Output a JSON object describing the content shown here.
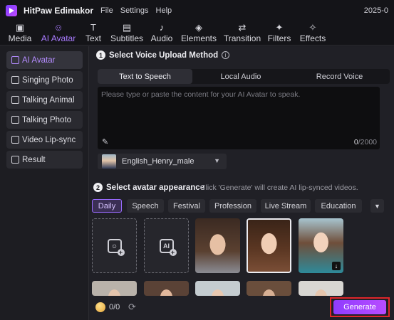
{
  "app": {
    "name": "HitPaw Edimakor",
    "date": "2025-0"
  },
  "menu": [
    "File",
    "Settings",
    "Help"
  ],
  "toolbar": [
    {
      "label": "Media",
      "icon": "media-icon",
      "glyph": "▣"
    },
    {
      "label": "AI Avatar",
      "icon": "ai-avatar-icon",
      "glyph": "☺",
      "active": true
    },
    {
      "label": "Text",
      "icon": "text-icon",
      "glyph": "T"
    },
    {
      "label": "Subtitles",
      "icon": "subtitles-icon",
      "glyph": "▤"
    },
    {
      "label": "Audio",
      "icon": "audio-icon",
      "glyph": "♪"
    },
    {
      "label": "Elements",
      "icon": "elements-icon",
      "glyph": "◈"
    },
    {
      "label": "Transition",
      "icon": "transition-icon",
      "glyph": "⇄"
    },
    {
      "label": "Filters",
      "icon": "filters-icon",
      "glyph": "✦"
    },
    {
      "label": "Effects",
      "icon": "effects-icon",
      "glyph": "✧"
    }
  ],
  "sidebar": {
    "items": [
      {
        "label": "AI Avatar",
        "icon": "ai-avatar-icon",
        "active": true
      },
      {
        "label": "Singing Photo",
        "icon": "singing-photo-icon"
      },
      {
        "label": "Talking Animal",
        "icon": "talking-animal-icon"
      },
      {
        "label": "Talking Photo",
        "icon": "talking-photo-icon"
      },
      {
        "label": "Video Lip-sync",
        "icon": "video-lipsync-icon"
      },
      {
        "label": "Result",
        "icon": "result-icon"
      }
    ]
  },
  "step1": {
    "num": "1",
    "title": "Select Voice Upload Method",
    "tabs": [
      "Text to Speech",
      "Local Audio",
      "Record Voice"
    ],
    "active_tab": "Text to Speech",
    "placeholder": "Please type or paste the content for your AI Avatar to speak.",
    "count_current": "0",
    "count_max": "/2000",
    "voice": "English_Henry_male"
  },
  "step2": {
    "num": "2",
    "title": "Select avatar appearance",
    "hint": "Click 'Generate' will create AI lip-synced videos.",
    "categories": [
      "Daily",
      "Speech",
      "Festival",
      "Profession",
      "Live Stream",
      "Education"
    ],
    "active_category": "Daily"
  },
  "footer": {
    "credits": "0/0",
    "generate_label": "Generate"
  },
  "colors": {
    "accent": "#a97bff",
    "generate_bg": "#9a40ff",
    "highlight_frame": "#e0262a"
  }
}
